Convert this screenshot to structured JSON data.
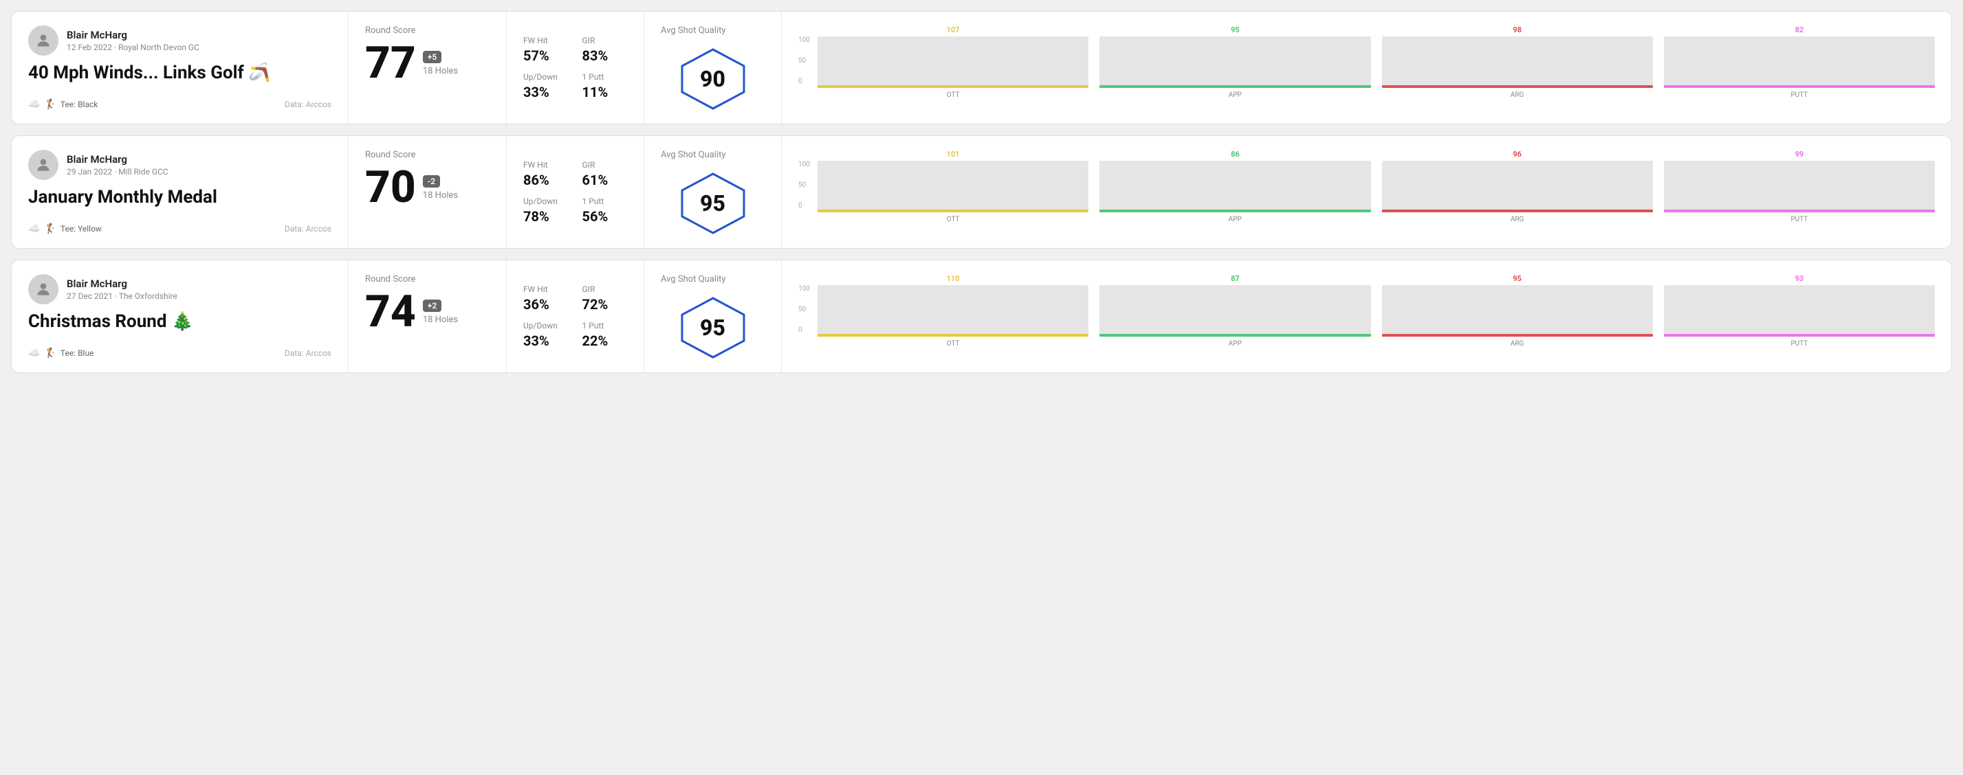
{
  "rounds": [
    {
      "name": "Blair McHarg",
      "dateCourse": "12 Feb 2022 · Royal North Devon GC",
      "title": "40 Mph Winds... Links Golf 🪃",
      "tee": "Tee: Black",
      "dataSource": "Data: Arccos",
      "score": "77",
      "scoreBadge": "+5",
      "badgeType": "positive",
      "holes": "18 Holes",
      "fwHit": "57%",
      "gir": "83%",
      "upDown": "33%",
      "onePutt": "11%",
      "avgShotQuality": "90",
      "chart": {
        "ott": {
          "value": "107",
          "color": "#e8c840",
          "pct": 75
        },
        "app": {
          "value": "95",
          "color": "#50c878",
          "pct": 62
        },
        "arg": {
          "value": "98",
          "color": "#e05050",
          "pct": 65
        },
        "putt": {
          "value": "82",
          "color": "#e878e8",
          "pct": 55
        }
      }
    },
    {
      "name": "Blair McHarg",
      "dateCourse": "29 Jan 2022 · Mill Ride GCC",
      "title": "January Monthly Medal",
      "tee": "Tee: Yellow",
      "dataSource": "Data: Arccos",
      "score": "70",
      "scoreBadge": "-2",
      "badgeType": "negative",
      "holes": "18 Holes",
      "fwHit": "86%",
      "gir": "61%",
      "upDown": "78%",
      "onePutt": "56%",
      "avgShotQuality": "95",
      "chart": {
        "ott": {
          "value": "101",
          "color": "#e8c840",
          "pct": 78
        },
        "app": {
          "value": "86",
          "color": "#50c878",
          "pct": 58
        },
        "arg": {
          "value": "96",
          "color": "#e05050",
          "pct": 72
        },
        "putt": {
          "value": "99",
          "color": "#e878e8",
          "pct": 76
        }
      }
    },
    {
      "name": "Blair McHarg",
      "dateCourse": "27 Dec 2021 · The Oxfordshire",
      "title": "Christmas Round 🎄",
      "tee": "Tee: Blue",
      "dataSource": "Data: Arccos",
      "score": "74",
      "scoreBadge": "+2",
      "badgeType": "positive",
      "holes": "18 Holes",
      "fwHit": "36%",
      "gir": "72%",
      "upDown": "33%",
      "onePutt": "22%",
      "avgShotQuality": "95",
      "chart": {
        "ott": {
          "value": "110",
          "color": "#e8c840",
          "pct": 82
        },
        "app": {
          "value": "87",
          "color": "#50c878",
          "pct": 58
        },
        "arg": {
          "value": "95",
          "color": "#e05050",
          "pct": 70
        },
        "putt": {
          "value": "93",
          "color": "#e878e8",
          "pct": 68
        }
      }
    }
  ],
  "labels": {
    "roundScore": "Round Score",
    "fwHit": "FW Hit",
    "gir": "GIR",
    "upDown": "Up/Down",
    "onePutt": "1 Putt",
    "avgShotQuality": "Avg Shot Quality",
    "dataArccos": "Data: Arccos",
    "ott": "OTT",
    "app": "APP",
    "arg": "ARG",
    "putt": "PUTT",
    "y100": "100",
    "y50": "50",
    "y0": "0"
  }
}
